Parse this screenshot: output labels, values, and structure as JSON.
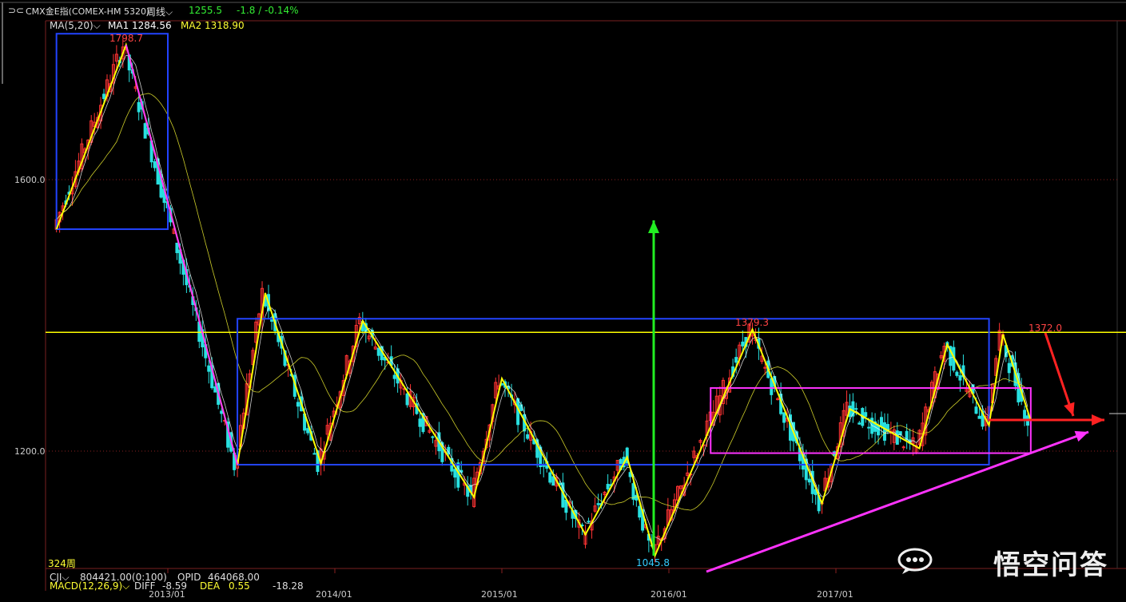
{
  "header": {
    "symbol_icon": "link-icon",
    "symbol": "CMX金E指(COMEX-HM 5320)",
    "period": "周线",
    "last": "1255.5",
    "change": "-1.8 / -0.14%",
    "ma_label": "MA(5,20)",
    "ma1": "MA1 1284.56",
    "ma2": "MA2 1318.90"
  },
  "bottom": {
    "bars": "324周",
    "cji_label": "CJI",
    "cji_value": "804421.00(0:100)",
    "opid": "OPID",
    "opid_value": "464068.00",
    "macd_label": "MACD(12,26,9)",
    "diff": "DIFF",
    "diff_value": "-8.59",
    "dea": "DEA",
    "dea_value": "0.55",
    "macd_value": "-18.28"
  },
  "watermark": {
    "icon": "speech-bubble-icon",
    "text": "悟空问答"
  },
  "colors": {
    "up": "#ff3333",
    "down": "#28e0e0",
    "ma1": "#ffffff",
    "ma2": "#ffff33",
    "zigzag": "#ffff00",
    "box_blue": "#2244ff",
    "box_magenta": "#ff33ff",
    "arrow_green": "#22ee22",
    "arrow_red": "#ff2222"
  },
  "chart_data": {
    "type": "line",
    "instrument": "COMEX gold weekly",
    "x_ticks": [
      "2013/01",
      "2014/01",
      "2015/01",
      "2016/01",
      "2017/01"
    ],
    "y_ticks": [
      "1600.0",
      "1200.0"
    ],
    "ylim": [
      1030,
      1830
    ],
    "grid": true,
    "annotations": [
      {
        "label": "1798.7",
        "x": "2012/10",
        "y": 1798.7
      },
      {
        "label": "1379.3",
        "x": "2016/07",
        "y": 1379.3
      },
      {
        "label": "1372.0",
        "x": "2018/01",
        "y": 1372.0
      },
      {
        "label": "1045.8",
        "x": "2015/12",
        "y": 1045.8
      }
    ],
    "resistance_line": 1375,
    "zigzag": [
      {
        "x": "2012/05",
        "y": 1527
      },
      {
        "x": "2012/10",
        "y": 1798.7
      },
      {
        "x": "2013/06",
        "y": 1180
      },
      {
        "x": "2013/08",
        "y": 1433
      },
      {
        "x": "2013/12",
        "y": 1182
      },
      {
        "x": "2014/03",
        "y": 1392
      },
      {
        "x": "2014/11",
        "y": 1132
      },
      {
        "x": "2015/01",
        "y": 1307
      },
      {
        "x": "2015/07",
        "y": 1077
      },
      {
        "x": "2015/10",
        "y": 1191
      },
      {
        "x": "2015/12",
        "y": 1045.8
      },
      {
        "x": "2016/07",
        "y": 1379.3
      },
      {
        "x": "2016/12",
        "y": 1123
      },
      {
        "x": "2017/02",
        "y": 1262
      },
      {
        "x": "2017/07",
        "y": 1204
      },
      {
        "x": "2017/09",
        "y": 1357
      },
      {
        "x": "2017/12",
        "y": 1238
      },
      {
        "x": "2018/01",
        "y": 1372.0
      },
      {
        "x": "2018/03",
        "y": 1245
      }
    ],
    "boxes": [
      {
        "x0": "2012/05",
        "x1": "2013/01",
        "y0": 1527,
        "y1": 1815
      },
      {
        "x0": "2013/06",
        "x1": "2017/12",
        "y0": 1180,
        "y1": 1395
      },
      {
        "x0": "2016/04",
        "x1": "2018/03",
        "y0": 1197,
        "y1": 1293
      }
    ]
  }
}
